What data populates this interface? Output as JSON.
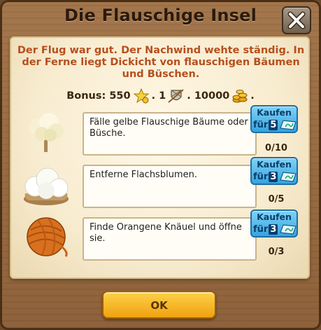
{
  "dialog": {
    "title": "Die Flauschige Insel",
    "story": "Der Flug war gut. Der Nachwind wehte ständig. In der Ferne liegt Dickicht von flauschigen Bäumen und Büschen.",
    "bonus": {
      "label": "Bonus: 550",
      "xp_icon": "star-coins-icon",
      "sep1": ". 1",
      "item_icon": "shield-sword-icon",
      "sep2": ". 10000",
      "coins_icon": "gold-coins-icon",
      "end": "."
    },
    "tasks": [
      {
        "icon": "fluffy-tree-icon",
        "text": "Fälle gelbe Flauschige Bäume oder Büsche.",
        "buy_label": "Kaufen",
        "buy_prefix": "für",
        "buy_cost": "5",
        "progress": "0/10"
      },
      {
        "icon": "flax-flower-icon",
        "text": "Entferne Flachsblumen.",
        "buy_label": "Kaufen",
        "buy_prefix": "für",
        "buy_cost": "3",
        "progress": "0/5"
      },
      {
        "icon": "yarn-ball-icon",
        "text": "Finde Orangene Knäuel und öffne sie.",
        "buy_label": "Kaufen",
        "buy_prefix": "für",
        "buy_cost": "3",
        "progress": "0/3"
      }
    ],
    "ok_label": "OK"
  },
  "colors": {
    "story": "#b5501e",
    "buy": "#35a4e0",
    "ok": "#f0a10f"
  }
}
